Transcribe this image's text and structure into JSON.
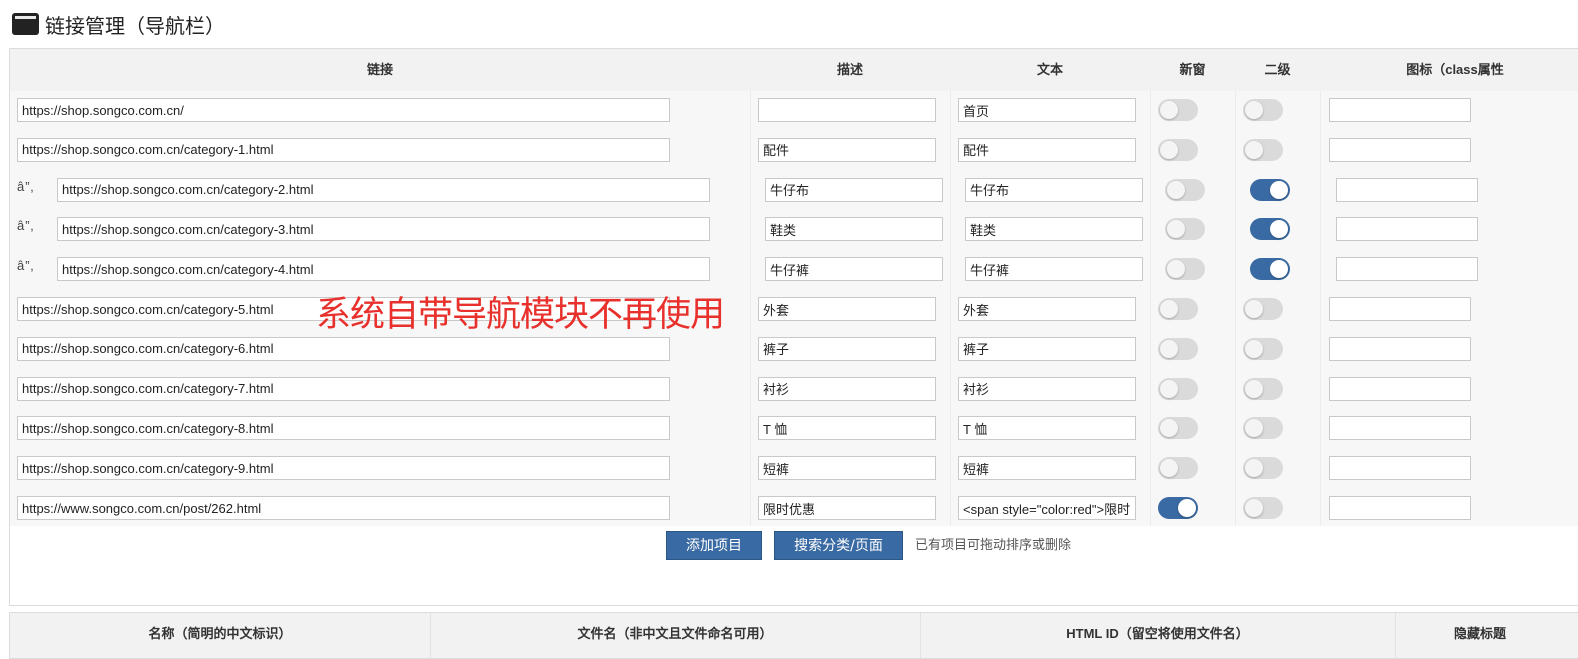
{
  "page": {
    "title": "链接管理（导航栏）"
  },
  "table": {
    "headers": {
      "link": "链接",
      "desc": "描述",
      "text": "文本",
      "new_window": "新窗",
      "level2": "二级",
      "icon": "图标（class属性"
    },
    "rows": [
      {
        "handle": "",
        "link": "https://shop.songco.com.cn/",
        "desc": "",
        "text": "首页",
        "new_window": false,
        "level2": false,
        "icon": ""
      },
      {
        "handle": "",
        "link": "https://shop.songco.com.cn/category-1.html",
        "desc": "配件",
        "text": "配件",
        "new_window": false,
        "level2": false,
        "icon": ""
      },
      {
        "handle": "â”‚",
        "link": "https://shop.songco.com.cn/category-2.html",
        "desc": "牛仔布",
        "text": "牛仔布",
        "new_window": false,
        "level2": true,
        "icon": ""
      },
      {
        "handle": "â”‚",
        "link": "https://shop.songco.com.cn/category-3.html",
        "desc": "鞋类",
        "text": "鞋类",
        "new_window": false,
        "level2": true,
        "icon": ""
      },
      {
        "handle": "â”‚",
        "link": "https://shop.songco.com.cn/category-4.html",
        "desc": "牛仔裤",
        "text": "牛仔裤",
        "new_window": false,
        "level2": true,
        "icon": ""
      },
      {
        "handle": "",
        "link": "https://shop.songco.com.cn/category-5.html",
        "desc": "外套",
        "text": "外套",
        "new_window": false,
        "level2": false,
        "icon": ""
      },
      {
        "handle": "",
        "link": "https://shop.songco.com.cn/category-6.html",
        "desc": "裤子",
        "text": "裤子",
        "new_window": false,
        "level2": false,
        "icon": ""
      },
      {
        "handle": "",
        "link": "https://shop.songco.com.cn/category-7.html",
        "desc": "衬衫",
        "text": "衬衫",
        "new_window": false,
        "level2": false,
        "icon": ""
      },
      {
        "handle": "",
        "link": "https://shop.songco.com.cn/category-8.html",
        "desc": "T 恤",
        "text": "T 恤",
        "new_window": false,
        "level2": false,
        "icon": ""
      },
      {
        "handle": "",
        "link": "https://shop.songco.com.cn/category-9.html",
        "desc": "短裤",
        "text": "短裤",
        "new_window": false,
        "level2": false,
        "icon": ""
      },
      {
        "handle": "",
        "link": "https://www.songco.com.cn/post/262.html",
        "desc": "限时优惠",
        "text": "<span style=\"color:red\">限时",
        "new_window": true,
        "level2": false,
        "icon": ""
      }
    ]
  },
  "actions": {
    "add_item": "添加项目",
    "search_category": "搜索分类/页面",
    "hint": "已有项目可拖动排序或删除"
  },
  "overlay_notice": "系统自带导航模块不再使用",
  "second_table": {
    "headers": {
      "name": "名称（简明的中文标识）",
      "filename": "文件名（非中文且文件命名可用）",
      "html_id": "HTML ID（留空将使用文件名）",
      "hide_title": "隐藏标题"
    }
  },
  "colors": {
    "accent": "#3a6aa3",
    "notice": "#e8312c",
    "header_bg": "#f2f2f2"
  }
}
